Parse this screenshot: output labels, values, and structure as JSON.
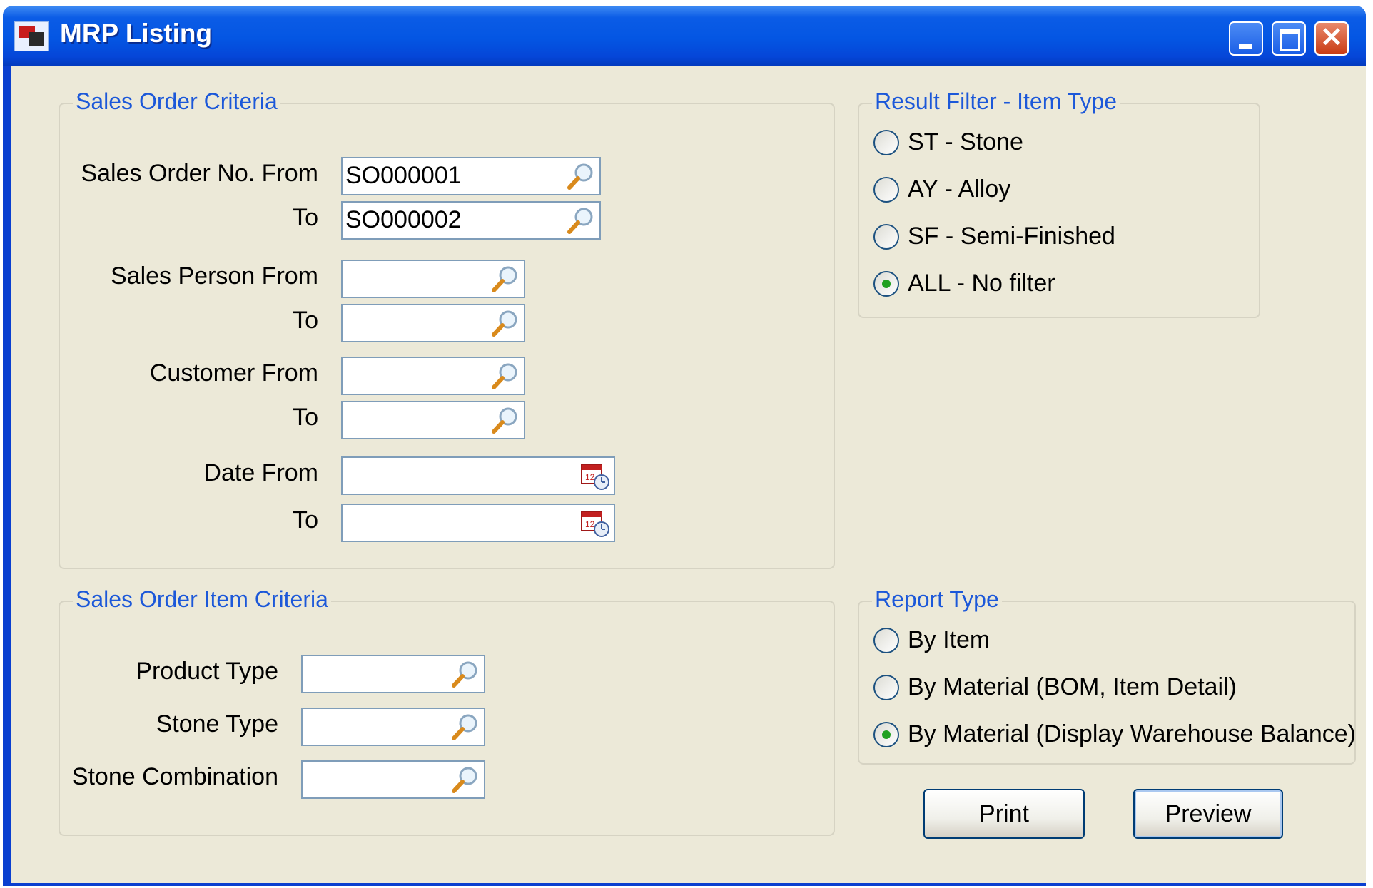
{
  "window": {
    "title": "MRP Listing"
  },
  "sales_order_criteria": {
    "legend": "Sales Order Criteria",
    "so_from_label": "Sales Order No. From",
    "so_from_value": "SO000001",
    "so_to_label": "To",
    "so_to_value": "SO000002",
    "sp_from_label": "Sales Person From",
    "sp_from_value": "",
    "sp_to_label": "To",
    "sp_to_value": "",
    "cust_from_label": "Customer From",
    "cust_from_value": "",
    "cust_to_label": "To",
    "cust_to_value": "",
    "date_from_label": "Date From",
    "date_from_value": "",
    "date_to_label": "To",
    "date_to_value": ""
  },
  "item_criteria": {
    "legend": "Sales Order Item Criteria",
    "product_type_label": "Product Type",
    "product_type_value": "",
    "stone_type_label": "Stone Type",
    "stone_type_value": "",
    "stone_comb_label": "Stone Combination",
    "stone_comb_value": ""
  },
  "result_filter": {
    "legend": "Result Filter - Item Type",
    "options": [
      {
        "label": "ST - Stone",
        "checked": false
      },
      {
        "label": "AY - Alloy",
        "checked": false
      },
      {
        "label": "SF - Semi-Finished",
        "checked": false
      },
      {
        "label": "ALL - No filter",
        "checked": true
      }
    ]
  },
  "report_type": {
    "legend": "Report Type",
    "options": [
      {
        "label": "By Item",
        "checked": false
      },
      {
        "label": "By Material (BOM, Item Detail)",
        "checked": false
      },
      {
        "label": "By Material (Display Warehouse Balance)",
        "checked": true
      }
    ]
  },
  "buttons": {
    "print": "Print",
    "preview": "Preview"
  },
  "icons": {
    "lookup": "magnifier-icon",
    "calendar": "calendar-clock-icon"
  },
  "colors": {
    "title_bar": "#0456e3",
    "legend_text": "#1c58d9",
    "dialog_bg": "#ece9d8",
    "radio_dot": "#21a121"
  }
}
